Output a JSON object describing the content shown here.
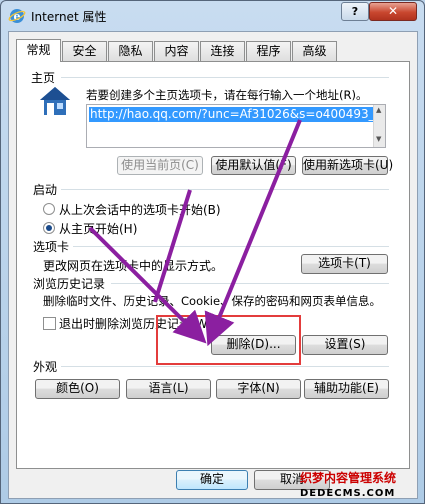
{
  "window": {
    "title": "Internet 属性",
    "help_label": "?",
    "close_label": "✕"
  },
  "tabs": [
    {
      "label": "常规",
      "active": true
    },
    {
      "label": "安全"
    },
    {
      "label": "隐私"
    },
    {
      "label": "内容"
    },
    {
      "label": "连接"
    },
    {
      "label": "程序"
    },
    {
      "label": "高级"
    }
  ],
  "home": {
    "group_label": "主页",
    "instruction": "若要创建多个主页选项卡，请在每行输入一个地址(R)。",
    "url_value": "http://hao.qq.com/?unc=Af31026&s=o400493_",
    "use_current": "使用当前页(C)",
    "use_default": "使用默认值(F)",
    "use_new_tab": "使用新选项卡(U)"
  },
  "startup": {
    "group_label": "启动",
    "option_last_session": "从上次会话中的选项卡开始(B)",
    "option_home": "从主页开始(H)"
  },
  "tabs_section": {
    "group_label": "选项卡",
    "description": "更改网页在选项卡中的显示方式。",
    "button": "选项卡(T)"
  },
  "history": {
    "group_label": "浏览历史记录",
    "description": "删除临时文件、历史记录、Cookie、保存的密码和网页表单信息。",
    "checkbox_label": "退出时删除浏览历史记录(W)",
    "delete_button": "删除(D)...",
    "settings_button": "设置(S)"
  },
  "appearance": {
    "group_label": "外观",
    "colors": "颜色(O)",
    "languages": "语言(L)",
    "fonts": "字体(N)",
    "accessibility": "辅助功能(E)"
  },
  "footer": {
    "ok": "确定",
    "cancel": "取消"
  },
  "watermark": {
    "line1": "织梦内容管理系统",
    "line2": "DEDECMS.COM"
  },
  "colors": {
    "annotation_arrow": "#8b1fa0",
    "highlight_box": "#e33c3c",
    "selection": "#3399ff"
  }
}
